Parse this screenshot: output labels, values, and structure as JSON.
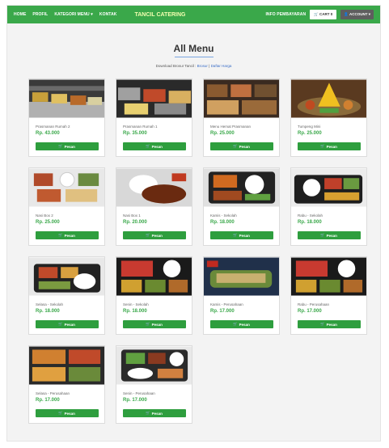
{
  "nav": {
    "links": [
      "HOME",
      "PROFIL",
      "KATEGORI MENU ▾",
      "KONTAK"
    ],
    "brand": "TANCIL CATERING",
    "info": "INFO PEMBAYARAN",
    "cart": "🛒 CART 0",
    "account": "👤 ACCOUNT ▾"
  },
  "page": {
    "title": "All Menu",
    "sub_text": "Download Brosur Tancil : ",
    "sub_link1": "Brosur",
    "sub_sep": " | ",
    "sub_link2": "Daftar Harga"
  },
  "buy_label": "Pesan",
  "icons": {
    "cart": "cart-icon"
  },
  "items": [
    {
      "name": "Prasmanan Rumah 2",
      "price": "Rp. 43.000"
    },
    {
      "name": "Prasmanan Rumah 1",
      "price": "Rp. 35.000"
    },
    {
      "name": "Menu Hemat Prasmanan",
      "price": "Rp. 25.000"
    },
    {
      "name": "Tumpeng Mini",
      "price": "Rp. 25.000"
    },
    {
      "name": "Nasi Box 2",
      "price": "Rp. 25.000"
    },
    {
      "name": "Nasi Box 1",
      "price": "Rp. 20.000"
    },
    {
      "name": "Kamis - Sekolah",
      "price": "Rp. 18.000"
    },
    {
      "name": "Rabu - Sekolah",
      "price": "Rp. 18.000"
    },
    {
      "name": "Selasa - Sekolah",
      "price": "Rp. 18.000"
    },
    {
      "name": "Senin - Sekolah",
      "price": "Rp. 18.000"
    },
    {
      "name": "Kamis - Perusahaan",
      "price": "Rp. 17.000"
    },
    {
      "name": "Rabu - Perusahaan",
      "price": "Rp. 17.000"
    },
    {
      "name": "Selasa - Perusahaan",
      "price": "Rp. 17.000"
    },
    {
      "name": "Senin - Perusahaan",
      "price": "Rp. 17.000"
    }
  ],
  "colors": {
    "accent": "#3aa84a",
    "button": "#2e9e3e",
    "brand": "#f3ffb0"
  }
}
